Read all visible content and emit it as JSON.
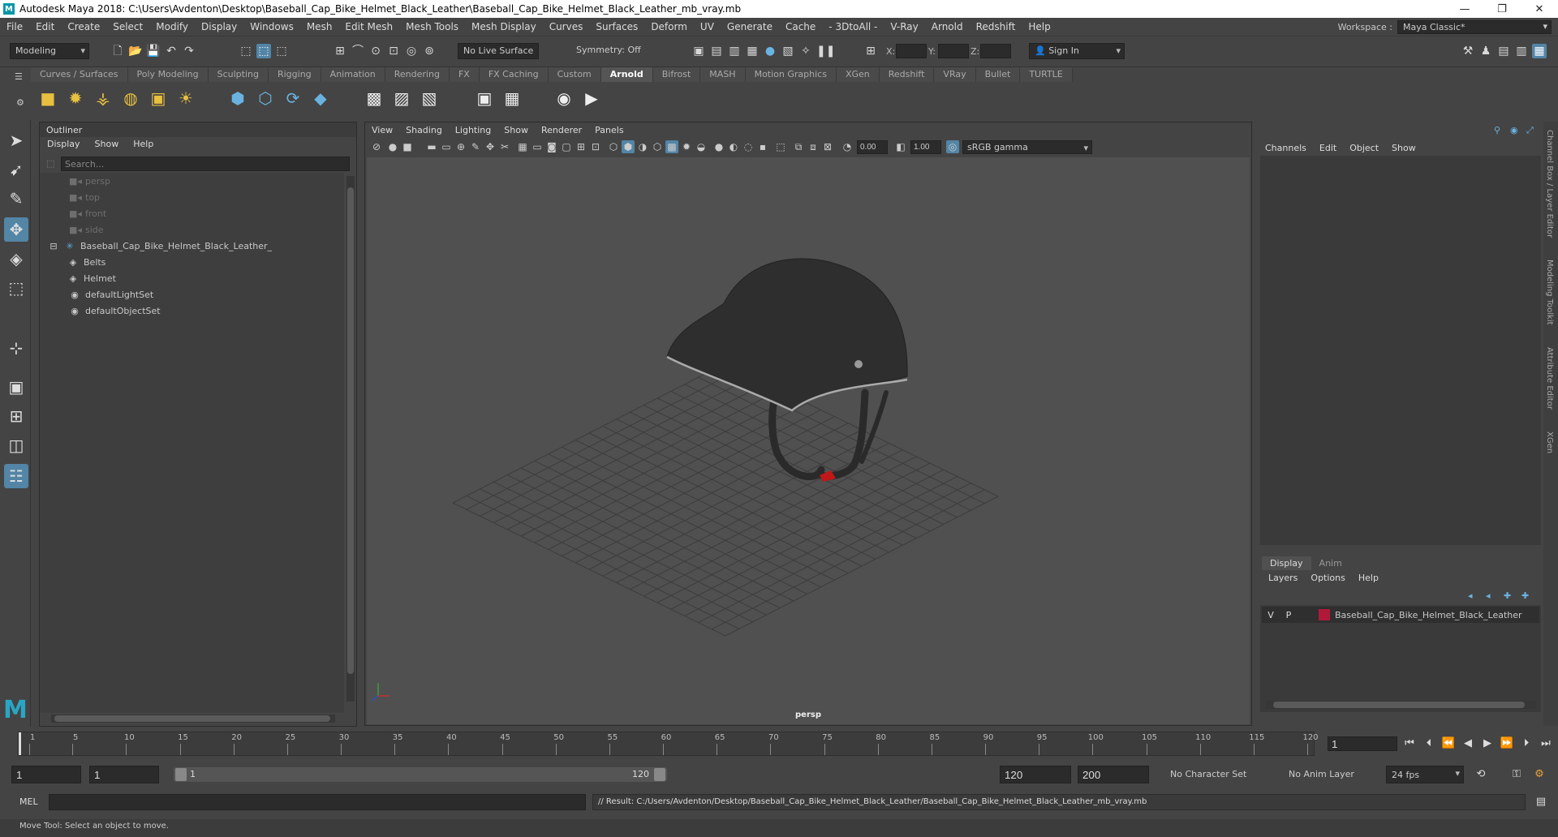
{
  "window": {
    "title": "Autodesk Maya 2018: C:\\Users\\Avdenton\\Desktop\\Baseball_Cap_Bike_Helmet_Black_Leather\\Baseball_Cap_Bike_Helmet_Black_Leather_mb_vray.mb",
    "minimize": "—",
    "maximize": "❐",
    "close": "✕"
  },
  "menubar": {
    "items": [
      "File",
      "Edit",
      "Create",
      "Select",
      "Modify",
      "Display",
      "Windows",
      "Mesh",
      "Edit Mesh",
      "Mesh Tools",
      "Mesh Display",
      "Curves",
      "Surfaces",
      "Deform",
      "UV",
      "Generate",
      "Cache",
      "- 3DtoAll -",
      "V-Ray",
      "Arnold",
      "Redshift",
      "Help"
    ],
    "workspace_label": "Workspace :",
    "workspace_value": "Maya Classic*"
  },
  "statusline": {
    "mode": "Modeling",
    "live_surface": "No Live Surface",
    "symmetry": "Symmetry: Off",
    "x_label": "X:",
    "y_label": "Y:",
    "z_label": "Z:",
    "sign_in": "Sign In"
  },
  "shelf": {
    "tabs": [
      "Curves / Surfaces",
      "Poly Modeling",
      "Sculpting",
      "Rigging",
      "Animation",
      "Rendering",
      "FX",
      "FX Caching",
      "Custom",
      "Arnold",
      "Bifrost",
      "MASH",
      "Motion Graphics",
      "XGen",
      "Redshift",
      "VRay",
      "Bullet",
      "TURTLE"
    ],
    "active_tab": "Arnold"
  },
  "outliner": {
    "title": "Outliner",
    "menu": [
      "Display",
      "Show",
      "Help"
    ],
    "search_placeholder": "Search...",
    "items": [
      {
        "label": "persp",
        "icon": "camera-icon",
        "dim": true
      },
      {
        "label": "top",
        "icon": "camera-icon",
        "dim": true
      },
      {
        "label": "front",
        "icon": "camera-icon",
        "dim": true
      },
      {
        "label": "side",
        "icon": "camera-icon",
        "dim": true
      },
      {
        "label": "Baseball_Cap_Bike_Helmet_Black_Leather_",
        "icon": "group-icon",
        "dim": false
      },
      {
        "label": "Belts",
        "icon": "mesh-icon",
        "dim": false
      },
      {
        "label": "Helmet",
        "icon": "mesh-icon",
        "dim": false
      },
      {
        "label": "defaultLightSet",
        "icon": "set-icon",
        "dim": false
      },
      {
        "label": "defaultObjectSet",
        "icon": "set-icon",
        "dim": false
      }
    ]
  },
  "viewport": {
    "menu": [
      "View",
      "Shading",
      "Lighting",
      "Show",
      "Renderer",
      "Panels"
    ],
    "near_value": "0.00",
    "far_value": "1.00",
    "color_space": "sRGB gamma",
    "camera_label": "persp"
  },
  "channelbox": {
    "menu": [
      "Channels",
      "Edit",
      "Object",
      "Show"
    ],
    "layer_tabs": [
      "Display",
      "Anim"
    ],
    "layer_menu": [
      "Layers",
      "Options",
      "Help"
    ],
    "layer": {
      "v": "V",
      "p": "P",
      "name": "Baseball_Cap_Bike_Helmet_Black_Leather",
      "color": "#b0193a"
    },
    "side_tabs": [
      "Channel Box / Layer Editor",
      "Modeling Toolkit",
      "Attribute Editor",
      "XGen"
    ]
  },
  "timeline": {
    "ticks": [
      1,
      5,
      10,
      15,
      20,
      25,
      30,
      35,
      40,
      45,
      50,
      55,
      60,
      65,
      70,
      75,
      80,
      85,
      90,
      95,
      100,
      105,
      110,
      115,
      120
    ],
    "current_frame": "1"
  },
  "range": {
    "start": "1",
    "inner_start": "1",
    "slider_start": "1",
    "slider_end": "120",
    "end": "120",
    "total_end": "200",
    "character_set": "No Character Set",
    "anim_layer": "No Anim Layer",
    "fps": "24 fps"
  },
  "command": {
    "lang": "MEL",
    "result": "// Result: C:/Users/Avdenton/Desktop/Baseball_Cap_Bike_Helmet_Black_Leather/Baseball_Cap_Bike_Helmet_Black_Leather_mb_vray.mb"
  },
  "helpline": "Move Tool: Select an object to move.",
  "colors": {
    "accent": "#5285a6",
    "panel": "#444444",
    "layer_swatch": "#b0193a"
  }
}
